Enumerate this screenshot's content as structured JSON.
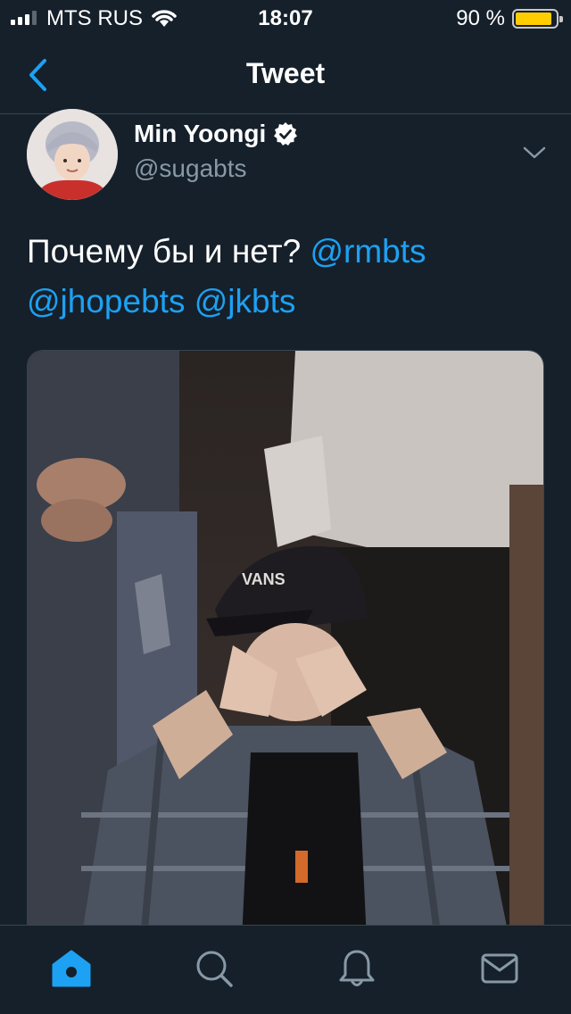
{
  "status_bar": {
    "carrier": "MTS RUS",
    "time": "18:07",
    "battery_percent": "90 %",
    "battery_level": 0.9,
    "signal_bars": 3,
    "battery_color": "#ffcc00"
  },
  "nav": {
    "title": "Tweet",
    "back_icon": "chevron-left-icon"
  },
  "tweet": {
    "author_name": "Min Yoongi",
    "handle": "@sugabts",
    "verified": true,
    "text_plain": "Почему бы и нет? ",
    "mentions": [
      "@rmbts",
      "@jhopebts",
      "@jkbts"
    ],
    "media": "photo"
  },
  "tab_bar": {
    "tabs": [
      {
        "name": "home",
        "icon": "home-icon",
        "active": true
      },
      {
        "name": "search",
        "icon": "search-icon",
        "active": false
      },
      {
        "name": "notifications",
        "icon": "bell-icon",
        "active": false
      },
      {
        "name": "messages",
        "icon": "envelope-icon",
        "active": false
      }
    ]
  },
  "colors": {
    "background": "#15202b",
    "accent": "#1da1f2",
    "secondary_text": "#8899a6",
    "divider": "#38444d"
  }
}
